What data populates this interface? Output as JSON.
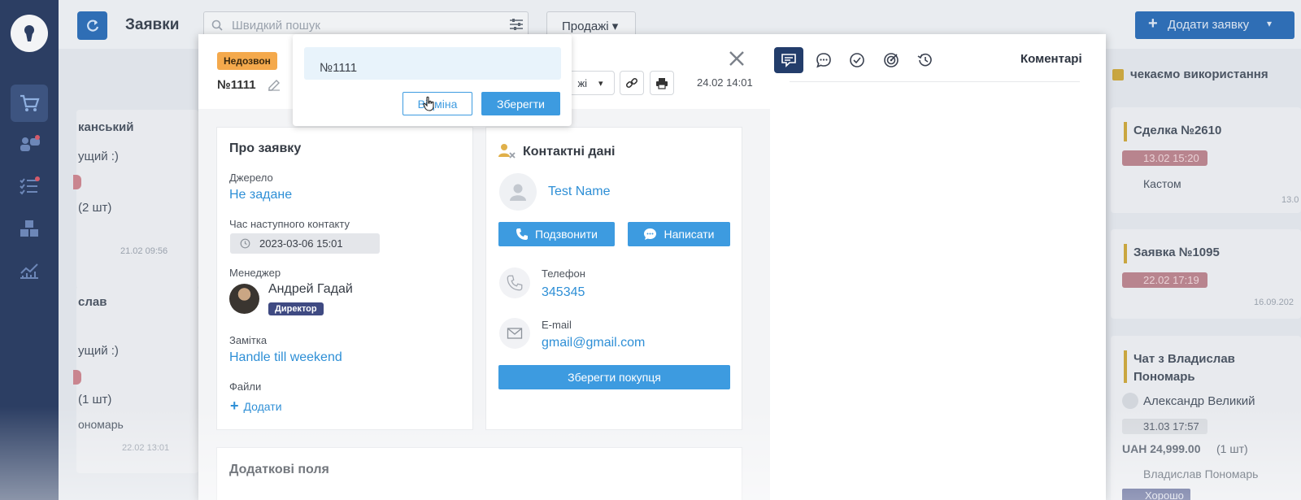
{
  "app": {
    "page_title": "Заявки",
    "search_placeholder": "Швидкий пошук",
    "filter_label": "Продажі",
    "add_button": "Додати заявку"
  },
  "background_left": {
    "items": [
      {
        "title": "канський",
        "sub": "ущий :)",
        "extra": "(2 шт)",
        "date": "21.02 09:56"
      },
      {
        "title": "слав",
        "sub": "ущий :)",
        "extra": "(1 шт)",
        "name": "ономарь",
        "date": "22.02 13:01"
      }
    ]
  },
  "background_right": {
    "header": "чекаємо використання",
    "cards": [
      {
        "title": "Сделка №2610",
        "date": "13.02 15:20",
        "person": "Кастом",
        "stamp": "13.0"
      },
      {
        "title": "Заявка №1095",
        "date": "22.02 17:19",
        "stamp": "16.09.202"
      },
      {
        "title": "Чат з Владислав Пономарь",
        "person": "Александр Великий",
        "date": "31.03 17:57",
        "amount": "UAH 24,999.00",
        "qty": "(1 шт)",
        "manager": "Владислав Пономарь",
        "status": "Хорошо"
      }
    ]
  },
  "modal": {
    "status_badge": "Недозвон",
    "order_number": "№1111",
    "channel": "жі",
    "date": "24.02 14:01",
    "popover": {
      "input_value": "№1111",
      "cancel": "Відміна",
      "save": "Зберегти"
    },
    "about": {
      "title": "Про заявку",
      "source_label": "Джерело",
      "source_value": "Не задане",
      "next_contact_label": "Час наступного контакту",
      "next_contact_value": "2023-03-06 15:01",
      "manager_label": "Менеджер",
      "manager_name": "Андрей Гадай",
      "manager_role": "Директор",
      "note_label": "Замітка",
      "note_value": "Handle till weekend",
      "files_label": "Файли",
      "files_add": "Додати"
    },
    "contact": {
      "title": "Контактні дані",
      "name": "Test Name",
      "call_button": "Подзвонити",
      "write_button": "Написати",
      "phone_label": "Телефон",
      "phone_value": "345345",
      "email_label": "E-mail",
      "email_value": "gmail@gmail.com",
      "save_button": "Зберегти покупця"
    },
    "extra": {
      "title": "Додаткові поля"
    },
    "right_panel": {
      "title": "Коментарі"
    }
  }
}
